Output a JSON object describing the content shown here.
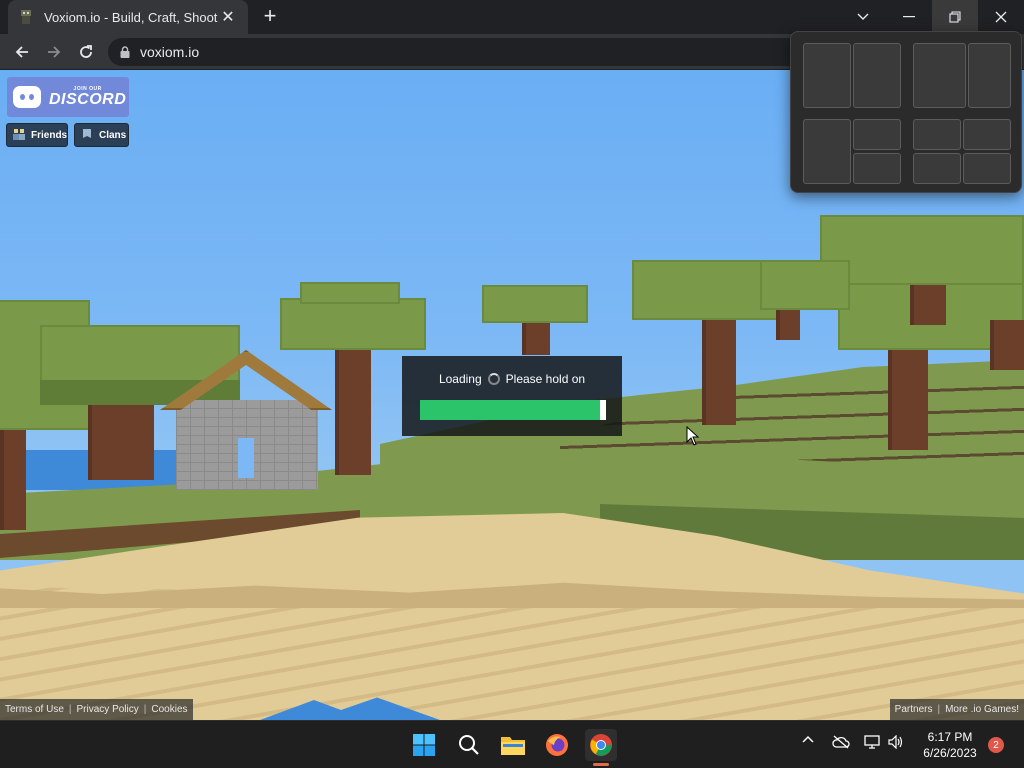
{
  "browser": {
    "tab_title": "Voxiom.io - Build, Craft, Shoot",
    "tab_close": "✕",
    "new_tab": "+",
    "url": "voxiom.io"
  },
  "hud": {
    "discord_small": "JOIN OUR",
    "discord_big": "DISCORD",
    "friends_label": "Friends",
    "clans_label": "Clans"
  },
  "loading": {
    "left_text": "Loading",
    "right_text": "Please hold on",
    "progress_fraction": 0.97
  },
  "footer": {
    "terms": "Terms of Use",
    "privacy": "Privacy Policy",
    "cookies": "Cookies",
    "partners": "Partners",
    "more_games": "More .io Games!"
  },
  "taskbar": {
    "time": "6:17 PM",
    "date": "6/26/2023",
    "notification_count": "2"
  },
  "colors": {
    "progress_fill": "#2bc46a",
    "discord": "#7289da",
    "sky": "#7cb8f5",
    "grass": "#7f9a4e",
    "sand": "#e1cb97"
  }
}
